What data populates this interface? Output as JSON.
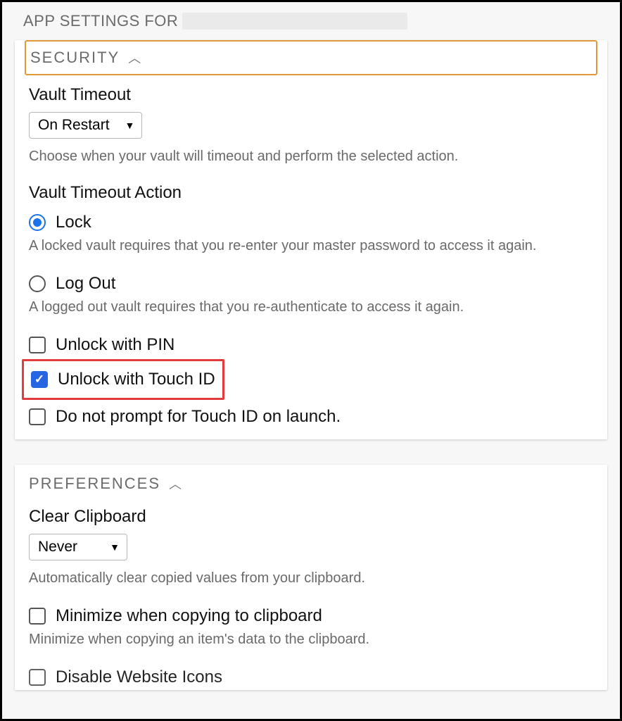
{
  "header": {
    "title_prefix": "APP SETTINGS FOR"
  },
  "security": {
    "heading": "SECURITY",
    "vault_timeout": {
      "title": "Vault Timeout",
      "value": "On Restart",
      "helper": "Choose when your vault will timeout and perform the selected action."
    },
    "vault_timeout_action": {
      "title": "Vault Timeout Action",
      "lock": {
        "label": "Lock",
        "helper": "A locked vault requires that you re-enter your master password to access it again."
      },
      "logout": {
        "label": "Log Out",
        "helper": "A logged out vault requires that you re-authenticate to access it again."
      }
    },
    "unlock_pin": {
      "label": "Unlock with PIN"
    },
    "unlock_touch": {
      "label": "Unlock with Touch ID"
    },
    "no_prompt_touch": {
      "label": "Do not prompt for Touch ID on launch."
    }
  },
  "preferences": {
    "heading": "PREFERENCES",
    "clear_clipboard": {
      "title": "Clear Clipboard",
      "value": "Never",
      "helper": "Automatically clear copied values from your clipboard."
    },
    "minimize_copy": {
      "label": "Minimize when copying to clipboard",
      "helper": "Minimize when copying an item's data to the clipboard."
    },
    "disable_icons": {
      "label": "Disable Website Icons"
    }
  }
}
